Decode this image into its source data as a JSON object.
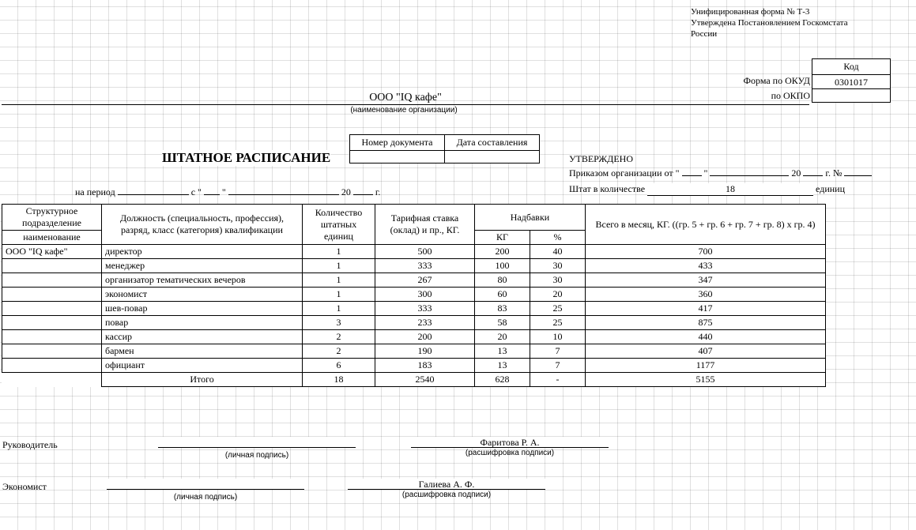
{
  "form_note": {
    "line1": "Унифицированная форма № Т-3",
    "line2": "Утверждена Постановлением Госкомстата",
    "line3": "России"
  },
  "codes": {
    "header": "Код",
    "okud_label": "Форма по ОКУД",
    "okud_value": "0301017",
    "okpo_label": "по ОКПО",
    "okpo_value": ""
  },
  "org_name": "ООО \"IQ кафе\"",
  "org_caption": "(наименование организации)",
  "document_title": "ШТАТНОЕ РАСПИСАНИЕ",
  "doc_meta": {
    "num_label": "Номер документа",
    "date_label": "Дата составления",
    "num_value": "",
    "date_value": ""
  },
  "approved": {
    "caption": "УТВЕРЖДЕНО",
    "order_prefix": "Приказом организации от \"",
    "order_mid": "\"",
    "order_year_prefix": "20",
    "order_year_suffix": "г.    №",
    "staff_label": "Штат в количестве",
    "staff_value": "18",
    "staff_units": "единиц"
  },
  "period": {
    "label": "на период",
    "from_open": "с \"",
    "from_close": "\"",
    "year_prefix": "20",
    "year_suffix": "г."
  },
  "columns": {
    "subdiv": "Структурное подразделение",
    "subdiv_name": "наименование",
    "position": "Должность (специальность, профессия), разряд, класс (категория) квалификации",
    "units": "Количество штатных единиц",
    "rate": "Тарифная ставка (оклад) и пр., КГ.",
    "allowances": "Надбавки",
    "allow_kg": "КГ",
    "allow_pct": "%",
    "total": "Всего в месяц, КГ. ((гр. 5 + гр. 6 + гр. 7 + гр. 8) x гр. 4)"
  },
  "rows": [
    {
      "subdiv": "ООО \"IQ кафе\"",
      "pos": "директор",
      "units": "1",
      "rate": "500",
      "kg": "200",
      "pct": "40",
      "total": "700"
    },
    {
      "subdiv": "",
      "pos": "менеджер",
      "units": "1",
      "rate": "333",
      "kg": "100",
      "pct": "30",
      "total": "433"
    },
    {
      "subdiv": "",
      "pos": "организатор тематических вечеров",
      "units": "1",
      "rate": "267",
      "kg": "80",
      "pct": "30",
      "total": "347"
    },
    {
      "subdiv": "",
      "pos": "экономист",
      "units": "1",
      "rate": "300",
      "kg": "60",
      "pct": "20",
      "total": "360"
    },
    {
      "subdiv": "",
      "pos": "шев-повар",
      "units": "1",
      "rate": "333",
      "kg": "83",
      "pct": "25",
      "total": "417"
    },
    {
      "subdiv": "",
      "pos": "повар",
      "units": "3",
      "rate": "233",
      "kg": "58",
      "pct": "25",
      "total": "875"
    },
    {
      "subdiv": "",
      "pos": "кассир",
      "units": "2",
      "rate": "200",
      "kg": "20",
      "pct": "10",
      "total": "440"
    },
    {
      "subdiv": "",
      "pos": "бармен",
      "units": "2",
      "rate": "190",
      "kg": "13",
      "pct": "7",
      "total": "407"
    },
    {
      "subdiv": "",
      "pos": "официант",
      "units": "6",
      "rate": "183",
      "kg": "13",
      "pct": "7",
      "total": "1177"
    }
  ],
  "totals": {
    "label": "Итого",
    "units": "18",
    "rate": "2540",
    "kg": "628",
    "pct": "-",
    "total": "5155"
  },
  "signatures": {
    "head_label": "Руководитель",
    "economist_label": "Экономист",
    "sig_caption": "(личная подпись)",
    "decode_caption": "(расшифровка подписи)",
    "head_name": "Фаритова Р. А.",
    "economist_name": "Галиева А. Ф."
  }
}
